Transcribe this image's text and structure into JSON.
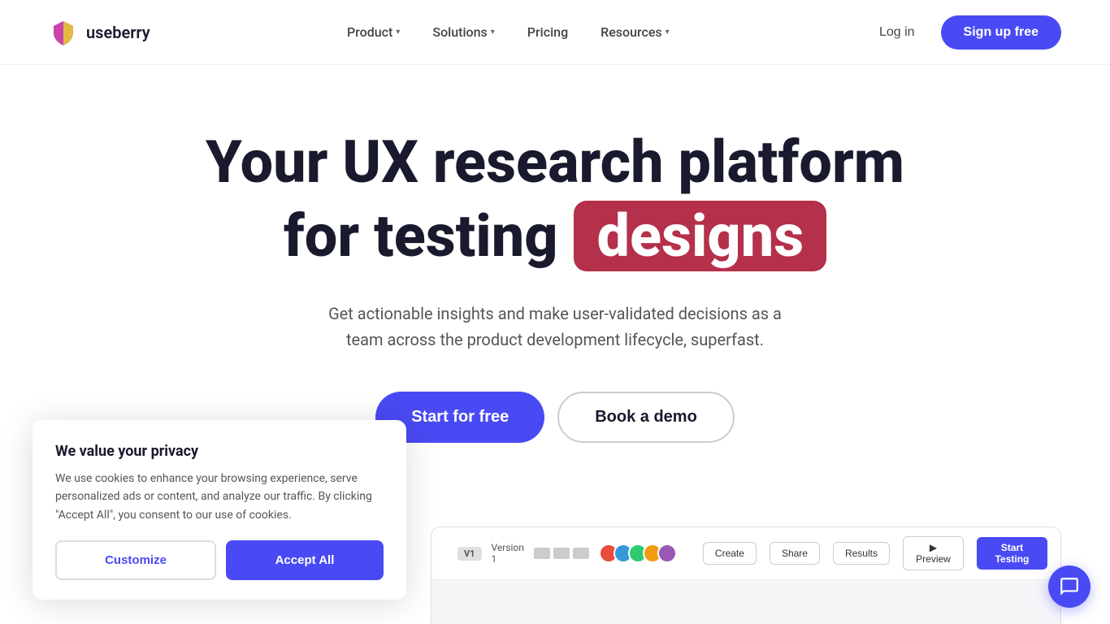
{
  "brand": {
    "name": "useberry",
    "logo_alt": "Useberry logo"
  },
  "nav": {
    "links": [
      {
        "label": "Product",
        "has_dropdown": true
      },
      {
        "label": "Solutions",
        "has_dropdown": true
      },
      {
        "label": "Pricing",
        "has_dropdown": false
      },
      {
        "label": "Resources",
        "has_dropdown": true
      }
    ],
    "login_label": "Log in",
    "signup_label": "Sign up free"
  },
  "hero": {
    "line1": "Your UX research platform",
    "line2_prefix": "for testing",
    "line2_highlight": "designs",
    "subtitle": "Get actionable insights and make user-validated decisions as a team across the product development lifecycle, superfast.",
    "cta_primary": "Start for free",
    "cta_secondary": "Book a demo"
  },
  "cookie": {
    "title": "We value your privacy",
    "body": "We use cookies to enhance your browsing experience, serve personalized ads or content, and analyze our traffic. By clicking \"Accept All\", you consent to our use of cookies.",
    "customize_label": "Customize",
    "accept_label": "Accept All"
  },
  "app_preview": {
    "version_label": "V1",
    "version_name": "Version 1",
    "nav_items": [
      "Create",
      "Share",
      "Results"
    ],
    "preview_btn": "Preview",
    "start_btn": "Start Testing"
  }
}
